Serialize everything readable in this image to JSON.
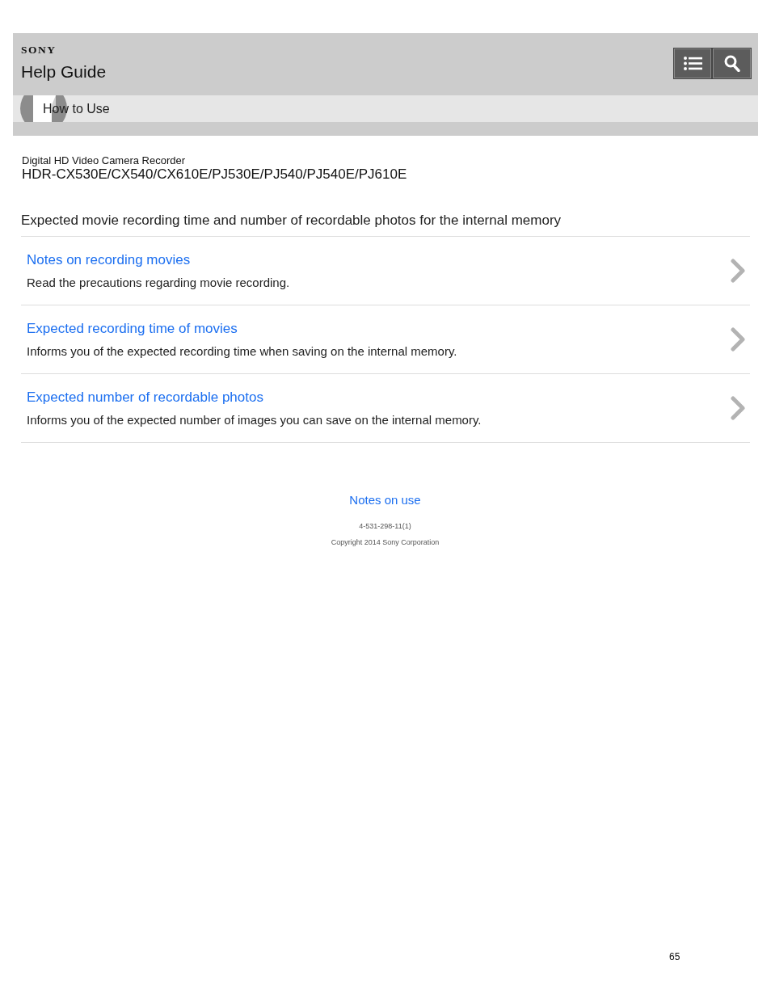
{
  "header": {
    "brand": "SONY",
    "title": "Help Guide"
  },
  "breadcrumb": {
    "label": "How to Use"
  },
  "product": {
    "type": "Digital HD Video Camera Recorder",
    "models": "HDR-CX530E/CX540/CX610E/PJ530E/PJ540/PJ540E/PJ610E"
  },
  "page_title": "Expected movie recording time and number of recordable photos for the internal memory",
  "topics": [
    {
      "title": "Notes on recording movies",
      "description": "Read the precautions regarding movie recording."
    },
    {
      "title": "Expected recording time of movies",
      "description": "Informs you of the expected recording time when saving on the internal memory."
    },
    {
      "title": "Expected number of recordable photos",
      "description": "Informs you of the expected number of images you can save on the internal memory."
    }
  ],
  "footer": {
    "link": "Notes on use",
    "code": "4-531-298-11(1)",
    "copyright": "Copyright 2014 Sony Corporation"
  },
  "page_number": "65"
}
